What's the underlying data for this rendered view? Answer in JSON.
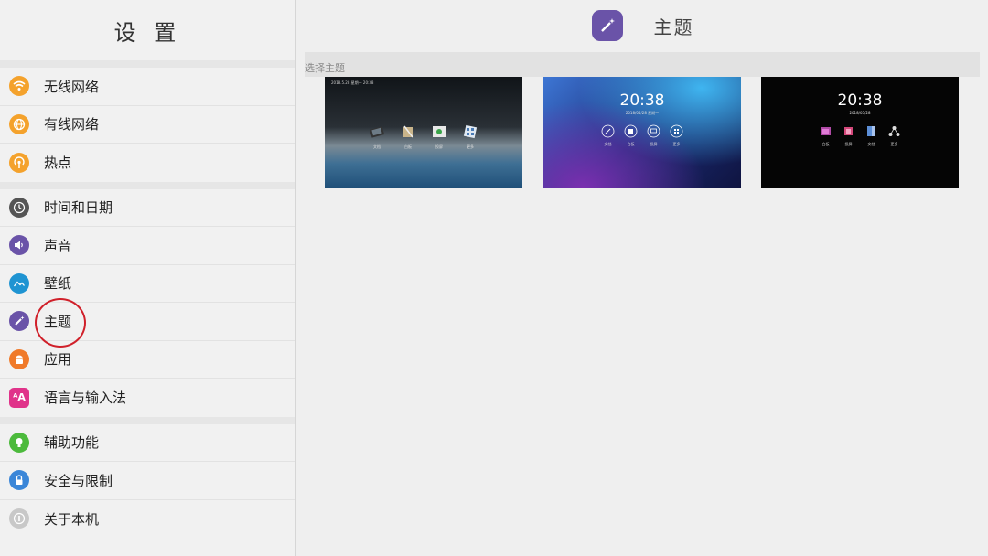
{
  "sidebar": {
    "title": "设 置",
    "groups": [
      [
        {
          "label": "无线网络",
          "icon": "wifi-icon",
          "color": "#f4a22c"
        },
        {
          "label": "有线网络",
          "icon": "globe-icon",
          "color": "#f4a22c"
        },
        {
          "label": "热点",
          "icon": "hotspot-icon",
          "color": "#f4a22c"
        }
      ],
      [
        {
          "label": "时间和日期",
          "icon": "clock-icon",
          "color": "#555555"
        },
        {
          "label": "声音",
          "icon": "speaker-icon",
          "color": "#6a53a8"
        },
        {
          "label": "壁纸",
          "icon": "wallpaper-icon",
          "color": "#1f94d2"
        },
        {
          "label": "主题",
          "icon": "magic-wand-icon",
          "color": "#6a53a8"
        },
        {
          "label": "应用",
          "icon": "android-icon",
          "color": "#f07a2a"
        },
        {
          "label": "语言与输入法",
          "icon": "language-icon",
          "color": "#e0338a"
        }
      ],
      [
        {
          "label": "辅助功能",
          "icon": "lightbulb-icon",
          "color": "#4cba3c"
        },
        {
          "label": "安全与限制",
          "icon": "lock-icon",
          "color": "#3a86d8"
        },
        {
          "label": "关于本机",
          "icon": "info-icon",
          "color": "#c8c8c8"
        }
      ]
    ]
  },
  "main": {
    "title": "主题",
    "section_label": "选择主题",
    "themes": [
      {
        "top_text": "2018.5.28  星期一   20:38",
        "apps": [
          "文档",
          "白板",
          "投屏",
          "更多"
        ]
      },
      {
        "time": "20:38",
        "date": "2018/05/28  星期一",
        "apps": [
          "文档",
          "白板",
          "投屏",
          "更多"
        ]
      },
      {
        "time": "20:38",
        "date": "2018/05/28",
        "apps": [
          "白板",
          "投屏",
          "文档",
          "更多"
        ]
      }
    ]
  }
}
